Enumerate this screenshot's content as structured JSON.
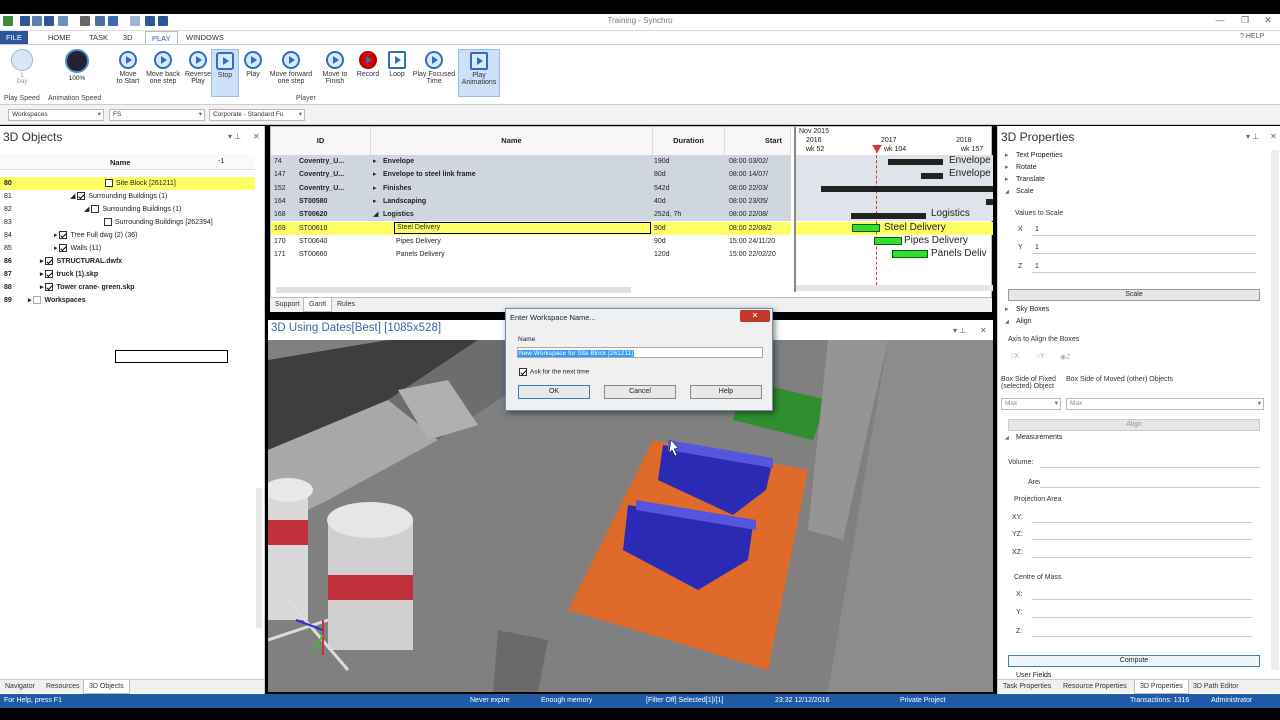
{
  "window": {
    "title": "Training - Synchro",
    "help": "HELP"
  },
  "menu": {
    "tabs": [
      "FILE",
      "HOME",
      "TASK",
      "3D",
      "PLAY",
      "WINDOWS"
    ],
    "active": "PLAY"
  },
  "ribbon": {
    "play_speed": {
      "value": "1",
      "unit": "Day",
      "label": "Play Speed"
    },
    "animation_speed": {
      "value": "100%",
      "label": "Animation Speed"
    },
    "buttons": [
      {
        "label": "Move\nto Start"
      },
      {
        "label": "Move back\none step"
      },
      {
        "label": "Reverse\nPlay"
      },
      {
        "label": "Stop"
      },
      {
        "label": "Play"
      },
      {
        "label": "Move forward\none step"
      },
      {
        "label": "Move to\nFinish"
      },
      {
        "label": "Record"
      },
      {
        "label": "Loop"
      },
      {
        "label": "Play Focused\nTime"
      },
      {
        "label": "Play\nAnimations"
      }
    ],
    "group_label": "Player"
  },
  "toolbar": {
    "workspaces": "Workspaces",
    "filter": "FS",
    "profile": "Corporate - Standard Fu"
  },
  "objects_panel": {
    "title": "3D Objects",
    "column": "Name",
    "sort": "-1",
    "rows": [
      {
        "num": "80",
        "label": "Site Block [261211]",
        "selected": true
      },
      {
        "num": "81",
        "label": "Surrounding Buildings (1)"
      },
      {
        "num": "82",
        "label": "Surrounding Buildings (1)"
      },
      {
        "num": "83",
        "label": "Surrounding Buildings [262394]"
      },
      {
        "num": "84",
        "label": "Tree Full dwg (2) (36)"
      },
      {
        "num": "85",
        "label": "Walls (11)"
      },
      {
        "num": "86",
        "label": "STRUCTURAL.dwfx"
      },
      {
        "num": "87",
        "label": "truck (1).skp"
      },
      {
        "num": "88",
        "label": "Tower crane- green.skp"
      },
      {
        "num": "89",
        "label": "Workspaces"
      }
    ],
    "tabs": [
      "Navigator",
      "Resources",
      "3D Objects"
    ]
  },
  "gantt": {
    "columns": [
      "ID",
      "Name",
      "Duration",
      "Start"
    ],
    "rows": [
      {
        "num": "74",
        "id": "Coventry_U...",
        "name": "Envelope",
        "duration": "190d",
        "start": "08:00 03/02/",
        "style": "gray"
      },
      {
        "num": "147",
        "id": "Coventry_U...",
        "name": "Envelope to steel link frame",
        "duration": "80d",
        "start": "08:00 14/07/",
        "style": "gray"
      },
      {
        "num": "152",
        "id": "Coventry_U...",
        "name": "Finishes",
        "duration": "542d",
        "start": "08:00 22/03/",
        "style": "gray"
      },
      {
        "num": "164",
        "id": "ST00580",
        "name": "Landscaping",
        "duration": "40d",
        "start": "08:00 23/05/",
        "style": "gray"
      },
      {
        "num": "168",
        "id": "ST00620",
        "name": "Logistics",
        "duration": "252d, 7h",
        "start": "08:00 22/08/",
        "style": "gray"
      },
      {
        "num": "169",
        "id": "ST00610",
        "name": "Steel Delivery",
        "duration": "90d",
        "start": "08:00 22/08/2",
        "style": "sel"
      },
      {
        "num": "170",
        "id": "ST00640",
        "name": "Pipes Delivery",
        "duration": "90d",
        "start": "15:00 24/11/20",
        "style": ""
      },
      {
        "num": "171",
        "id": "ST00660",
        "name": "Panels Delivery",
        "duration": "120d",
        "start": "15:00 22/02/20",
        "style": ""
      }
    ],
    "timeline": {
      "month": "Nov 2015",
      "y2016": "2016",
      "y2017": "2017",
      "y2018": "2018",
      "wk1": "wk 52",
      "wk2": "wk 104",
      "wk3": "wk 157"
    },
    "bar_labels": [
      "Envelope",
      "Envelope",
      "Logistics",
      "Steel Delivery",
      "Pipes Delivery",
      "Panels Deliv"
    ],
    "tabs": [
      "Support",
      "Gantt",
      "Rules"
    ]
  },
  "view": {
    "title": "3D Using Dates[Best] [1085x528]"
  },
  "dialog": {
    "title": "Enter Workspace Name...",
    "name_label": "Name",
    "name_value": "New Workspace for Site Block [261211]",
    "ask_label": "Ask for the next time",
    "ok": "OK",
    "cancel": "Cancel",
    "help": "Help"
  },
  "properties": {
    "title": "3D Properties",
    "sections": [
      "Text Properties",
      "Rotate",
      "Translate",
      "Scale"
    ],
    "values_to_scale": "Values to Scale",
    "x_label": "X",
    "y_label": "Y",
    "z_label": "Z",
    "x": "1",
    "y": "1",
    "z": "1",
    "scale_btn": "Scale",
    "sky_boxes": "Sky Boxes",
    "align": "Align",
    "axis_label": "Axis to Align the Boxes",
    "axis_x": "X",
    "axis_y": "Y",
    "axis_z": "Z",
    "fixed_label": "Box Side of Fixed (selected) Object",
    "moved_label": "Box Side of Moved (other) Objects",
    "fixed_value": "Max",
    "moved_value": "Max",
    "align_btn": "Align",
    "measurements": "Measurements",
    "volume": "Volume:",
    "area": "Area:",
    "projection_area": "Projection Area",
    "xy": "XY:",
    "yz": "YZ:",
    "xz": "XZ:",
    "centre_of_mass": "Centre of Mass",
    "cx": "X:",
    "cy": "Y:",
    "cz": "Z:",
    "compute_btn": "Compute",
    "user_fields": "User Fields",
    "tabs": [
      "Task Properties",
      "Resource Properties",
      "3D Properties",
      "3D Path Editor"
    ]
  },
  "status": {
    "help": "For Help, press F1",
    "expire": "Never expire",
    "memory": "Enough memory",
    "filter": "[Filter Off]  Selected[1]/[1]",
    "datetime": "23:32 12/12/2016",
    "project": "Private Project",
    "transactions": "Transactions: 1316",
    "user": "Administrator"
  }
}
